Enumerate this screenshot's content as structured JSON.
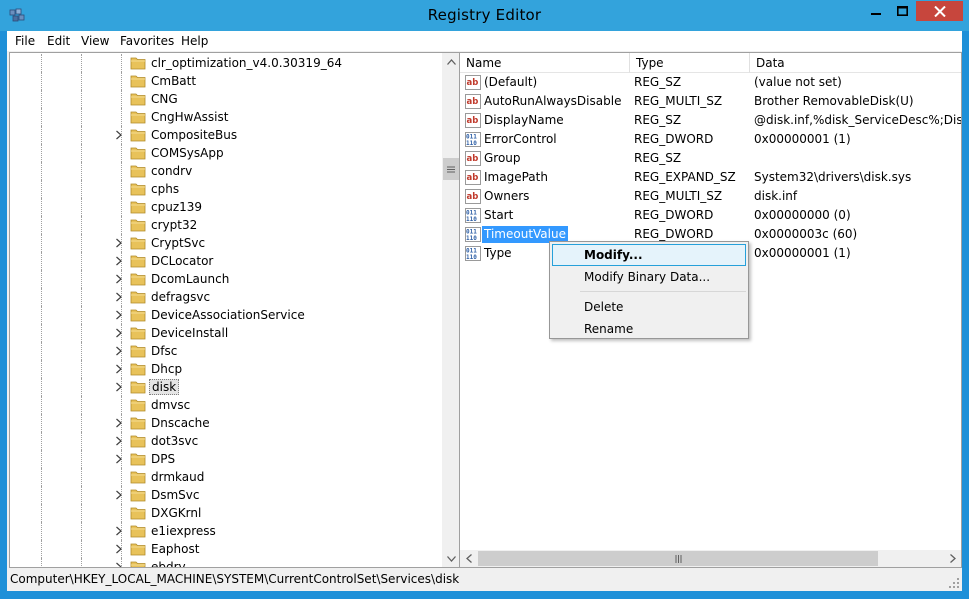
{
  "window": {
    "title": "Registry Editor",
    "title_icon": "regedit-icon",
    "controls": [
      "minimize-icon",
      "maximize-icon",
      "close-icon"
    ]
  },
  "menu": {
    "items": [
      "File",
      "Edit",
      "View",
      "Favorites",
      "Help"
    ]
  },
  "tree": {
    "items": [
      {
        "label": "clr_optimization_v4.0.30319_64",
        "expandable": false
      },
      {
        "label": "CmBatt",
        "expandable": false
      },
      {
        "label": "CNG",
        "expandable": false
      },
      {
        "label": "CngHwAssist",
        "expandable": false
      },
      {
        "label": "CompositeBus",
        "expandable": true
      },
      {
        "label": "COMSysApp",
        "expandable": false
      },
      {
        "label": "condrv",
        "expandable": false
      },
      {
        "label": "cphs",
        "expandable": false
      },
      {
        "label": "cpuz139",
        "expandable": false
      },
      {
        "label": "crypt32",
        "expandable": false
      },
      {
        "label": "CryptSvc",
        "expandable": true
      },
      {
        "label": "DCLocator",
        "expandable": true
      },
      {
        "label": "DcomLaunch",
        "expandable": true
      },
      {
        "label": "defragsvc",
        "expandable": true
      },
      {
        "label": "DeviceAssociationService",
        "expandable": true
      },
      {
        "label": "DeviceInstall",
        "expandable": true
      },
      {
        "label": "Dfsc",
        "expandable": true
      },
      {
        "label": "Dhcp",
        "expandable": true
      },
      {
        "label": "disk",
        "expandable": true,
        "selected": true
      },
      {
        "label": "dmvsc",
        "expandable": false
      },
      {
        "label": "Dnscache",
        "expandable": true
      },
      {
        "label": "dot3svc",
        "expandable": true
      },
      {
        "label": "DPS",
        "expandable": true
      },
      {
        "label": "drmkaud",
        "expandable": false
      },
      {
        "label": "DsmSvc",
        "expandable": true
      },
      {
        "label": "DXGKrnl",
        "expandable": false
      },
      {
        "label": "e1iexpress",
        "expandable": true
      },
      {
        "label": "Eaphost",
        "expandable": true
      },
      {
        "label": "ebdrv",
        "expandable": true
      }
    ]
  },
  "list": {
    "columns": [
      "Name",
      "Type",
      "Data"
    ],
    "rows": [
      {
        "icon": "string-value-icon",
        "name": "(Default)",
        "type": "REG_SZ",
        "data": "(value not set)"
      },
      {
        "icon": "string-value-icon",
        "name": "AutoRunAlwaysDisable",
        "type": "REG_MULTI_SZ",
        "data": "Brother RemovableDisk(U)"
      },
      {
        "icon": "string-value-icon",
        "name": "DisplayName",
        "type": "REG_SZ",
        "data": "@disk.inf,%disk_ServiceDesc%;Disk Drive"
      },
      {
        "icon": "binary-value-icon",
        "name": "ErrorControl",
        "type": "REG_DWORD",
        "data": "0x00000001 (1)"
      },
      {
        "icon": "string-value-icon",
        "name": "Group",
        "type": "REG_SZ",
        "data": ""
      },
      {
        "icon": "string-value-icon",
        "name": "ImagePath",
        "type": "REG_EXPAND_SZ",
        "data": "System32\\drivers\\disk.sys"
      },
      {
        "icon": "string-value-icon",
        "name": "Owners",
        "type": "REG_MULTI_SZ",
        "data": "disk.inf"
      },
      {
        "icon": "binary-value-icon",
        "name": "Start",
        "type": "REG_DWORD",
        "data": "0x00000000 (0)"
      },
      {
        "icon": "binary-value-icon",
        "name": "TimeoutValue",
        "type": "REG_DWORD",
        "data": "0x0000003c (60)",
        "selected": true
      },
      {
        "icon": "binary-value-icon",
        "name": "Type",
        "type": "",
        "data": "0x00000001 (1)"
      }
    ]
  },
  "context_menu": {
    "items": [
      {
        "label": "Modify...",
        "highlighted": true
      },
      {
        "label": "Modify Binary Data..."
      },
      {
        "separator": true
      },
      {
        "label": "Delete"
      },
      {
        "label": "Rename"
      }
    ]
  },
  "status": {
    "path": "Computer\\HKEY_LOCAL_MACHINE\\SYSTEM\\CurrentControlSet\\Services\\disk"
  },
  "colors": {
    "title_bar": "#33a3dc",
    "close_button": "#c7463d",
    "selection": "#3399ff",
    "menu_highlight_border": "#26a0da",
    "folder": "#e8c25a"
  }
}
